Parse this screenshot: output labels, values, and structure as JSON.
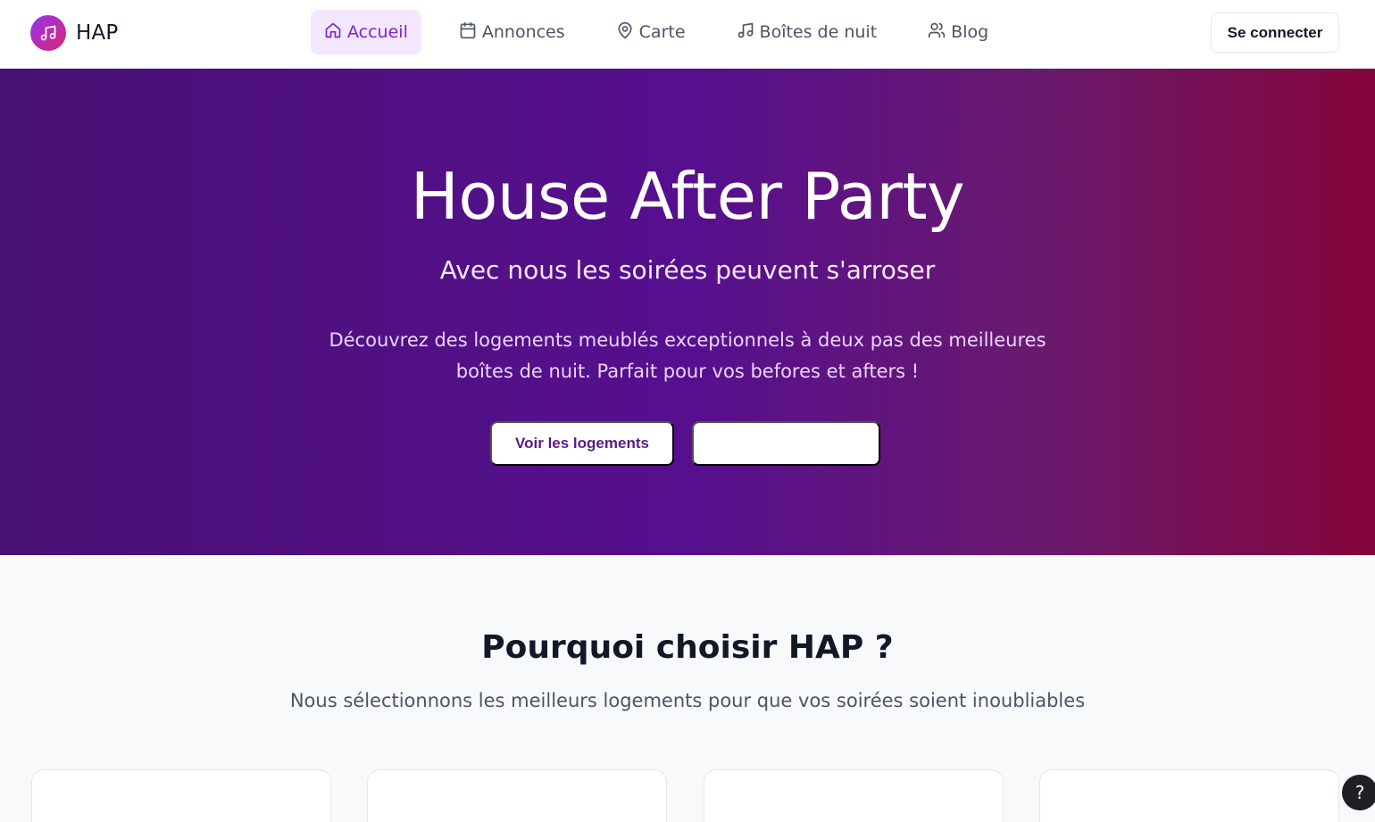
{
  "brand": {
    "name": "HAP",
    "logo_icon": "music-note-icon"
  },
  "nav": {
    "items": [
      {
        "label": "Accueil",
        "icon": "home-icon",
        "active": true
      },
      {
        "label": "Annonces",
        "icon": "calendar-icon",
        "active": false
      },
      {
        "label": "Carte",
        "icon": "map-pin-icon",
        "active": false
      },
      {
        "label": "Boîtes de nuit",
        "icon": "music-note-icon",
        "active": false
      },
      {
        "label": "Blog",
        "icon": "users-icon",
        "active": false
      }
    ]
  },
  "header": {
    "login_label": "Se connecter"
  },
  "hero": {
    "title": "House After Party",
    "subtitle": "Avec nous les soirées peuvent s'arroser",
    "description": "Découvrez des logements meublés exceptionnels à deux pas des meilleures boîtes de nuit. Parfait pour vos befores et afters !",
    "primary_button": "Voir les logements",
    "secondary_button": ""
  },
  "features": {
    "title": "Pourquoi choisir HAP ?",
    "subtitle": "Nous sélectionnons les meilleurs logements pour que vos soirées soient inoubliables"
  },
  "help": {
    "label": "?"
  },
  "colors": {
    "accent": "#7e22ce",
    "accent_bg": "#f3e8ff",
    "hero_start": "#4a1174",
    "hero_mid": "#560f8e",
    "hero_end": "#85043b",
    "logo_gradient_start": "#9333ea",
    "logo_gradient_end": "#db2777"
  }
}
